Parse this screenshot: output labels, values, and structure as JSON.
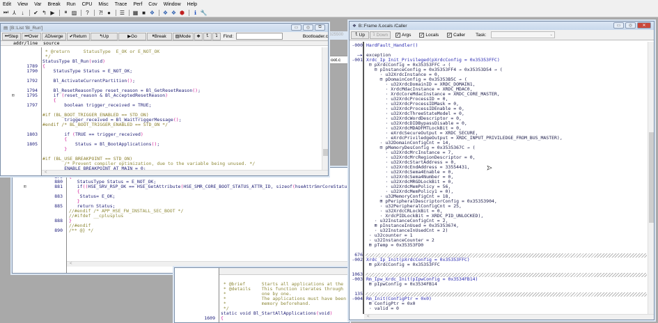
{
  "menu": [
    "Edit",
    "View",
    "Var",
    "Break",
    "Run",
    "CPU",
    "Misc",
    "Trace",
    "Perf",
    "Cov",
    "Window",
    "Help"
  ],
  "toolbar_icons": [
    "step-icon",
    "diverge-icon",
    "over-icon",
    "return-icon",
    "up-icon",
    "go-icon",
    "break-icon",
    "mode-icon",
    "help-icon",
    "context-help-icon",
    "stop-icon",
    "list-icon",
    "memory-icon",
    "register-icon",
    "frame-icon",
    "var-icon",
    "watch-icon",
    "bug-icon",
    "info-icon",
    "tool-icon"
  ],
  "list_window": {
    "title": "[B::List 'Bl_Run']",
    "buttons": [
      "Step",
      "Over",
      "Diverge",
      "Return",
      "Up",
      "Go",
      "Break",
      "Mode"
    ],
    "find_label": "Find:",
    "find_value": "",
    "file": "Bootloader.c",
    "header_addr": "addr/line",
    "header_source": "source",
    "lines": [
      {
        "n": "",
        "t": " * @return     StatusType  E_OK or E_NOT_OK",
        "c": "comment"
      },
      {
        "n": "",
        "t": " */",
        "c": "comment"
      },
      {
        "n": "",
        "t": "StatusType Bl_Run(void)",
        "c": ""
      },
      {
        "n": "1789",
        "t": "{",
        "c": "brace"
      },
      {
        "n": "1790",
        "t": "    StatusType Status = E_NOT_OK;",
        "c": ""
      },
      {
        "n": "",
        "t": "",
        "c": ""
      },
      {
        "n": "1792",
        "t": "    Bl_ActivateCurrentPartition();",
        "c": ""
      },
      {
        "n": "",
        "t": "",
        "c": ""
      },
      {
        "n": "1794",
        "t": "    Bl_ResetReasonType reset_reason = Bl_GetResetReason();",
        "c": ""
      },
      {
        "n": "1795",
        "t": "    if (reset_reason & Bl_AcceptedResetReason)",
        "c": "",
        "fold": true
      },
      {
        "n": "",
        "t": "    {",
        "c": "brace"
      },
      {
        "n": "1797",
        "t": "        boolean trigger_received = TRUE;",
        "c": ""
      },
      {
        "n": "",
        "t": "",
        "c": ""
      },
      {
        "n": "",
        "t": "#if (BL_BOOT_TRIGGER_ENABLED == STD_ON)",
        "c": "pre"
      },
      {
        "n": "",
        "t": "        trigger_received = Bl_WaitTriggerMessage();",
        "c": ""
      },
      {
        "n": "",
        "t": "#endif /* BL_BOOT_TRIGGER_ENABLED == STD_ON */",
        "c": "pre"
      },
      {
        "n": "",
        "t": "",
        "c": ""
      },
      {
        "n": "1803",
        "t": "        if (TRUE == trigger_received)",
        "c": ""
      },
      {
        "n": "",
        "t": "        {",
        "c": "brace"
      },
      {
        "n": "1805",
        "t": "            Status = Bl_BootApplications();",
        "c": ""
      },
      {
        "n": "",
        "t": "        }",
        "c": "brace"
      },
      {
        "n": "",
        "t": "",
        "c": ""
      },
      {
        "n": "",
        "t": "#if (BL_USE_BREAKPOINT == STD_ON)",
        "c": "pre"
      },
      {
        "n": "",
        "t": "        /* Prevent compiler optimization, due to the variable being unused. */",
        "c": "comment"
      },
      {
        "n": "",
        "t": "        ENABLE_BREAKPOINT_AT_MAIN = 0;",
        "c": ""
      }
    ]
  },
  "bg_window": {
    "behind_fragments": [
      "325500",
      "oot.c"
    ],
    "lines": [
      {
        "n": "879",
        "t": "{",
        "c": "brace"
      },
      {
        "n": "880",
        "t": "   StatusType Status = E_NOT_OK;",
        "c": ""
      },
      {
        "n": "881",
        "t": "   if((HSE_SRV_RSP_OK == HSE_GetAttribute(HSE_SMR_CORE_BOOT_STATUS_ATTR_ID, sizeof(hseAttrSmrCoreStatus",
        "c": "",
        "fold": true
      },
      {
        "n": "",
        "t": "   {",
        "c": "brace"
      },
      {
        "n": "883",
        "t": "    Status= E_OK;",
        "c": ""
      },
      {
        "n": "",
        "t": "   }",
        "c": "brace"
      },
      {
        "n": "885",
        "t": "   return Status;",
        "c": ""
      },
      {
        "n": "",
        "t": "//#endif /* APP_HSE_FW_INSTALL_SEC_BOOT */",
        "c": "comment"
      },
      {
        "n": "",
        "t": "//#ifdef __cplusplus",
        "c": "comment"
      },
      {
        "n": "888",
        "t": "}",
        "c": "brace"
      },
      {
        "n": "",
        "t": "//#endif",
        "c": "comment"
      },
      {
        "n": "890",
        "t": "/** @} */",
        "c": "comment"
      }
    ]
  },
  "bg_window2": {
    "lines": [
      {
        "n": "",
        "t": " * @brief      Starts all applications at the",
        "c": "comment"
      },
      {
        "n": "",
        "t": " * @details    This function iterates through",
        "c": "comment"
      },
      {
        "n": "",
        "t": " *             one by one.",
        "c": "comment"
      },
      {
        "n": "",
        "t": " *             The applications must have been",
        "c": "comment"
      },
      {
        "n": "",
        "t": " *             memory beforehand.",
        "c": "comment"
      },
      {
        "n": "",
        "t": " */",
        "c": "comment"
      },
      {
        "n": "",
        "t": "static void Bl_StartAllApplications(void)",
        "c": ""
      },
      {
        "n": "1609",
        "t": "{",
        "c": "brace"
      }
    ]
  },
  "frame_window": {
    "title": "B::Frame /Locals /Caller",
    "up": "Up",
    "down": "Down",
    "checks": [
      {
        "label": "Args",
        "checked": true
      },
      {
        "label": "Locals",
        "checked": true
      },
      {
        "label": "Caller",
        "checked": true
      }
    ],
    "task_label": "Task:",
    "task_value": "",
    "lines": [
      {
        "g": "-000",
        "t": "HardFault_Handler()",
        "c": "fn"
      },
      {
        "g": "",
        "t": "",
        "c": ""
      },
      {
        "g": "—▸",
        "t": "exception",
        "c": ""
      },
      {
        "g": "-001",
        "t": "Xrdc_Ip_Init_Privileged(pXrdcConfig = 0x35353FFC)",
        "c": "fn"
      },
      {
        "g": "",
        "t": " ⊟ pXrdcConfig = 0x35353FFC → (",
        "c": ""
      },
      {
        "g": "",
        "t": "   ⊟ pInstanceConfig = 0x35353FF4 → 0x35353D54 → (",
        "c": ""
      },
      {
        "g": "",
        "t": "     · u32XrdcInstance = 0,",
        "c": ""
      },
      {
        "g": "",
        "t": "     ⊟ pDomainConfig = 0x35353B5C → (",
        "c": ""
      },
      {
        "g": "",
        "t": "       · u32XrdcDomainID = XRDC_DOMAIN1,",
        "c": ""
      },
      {
        "g": "",
        "t": "       · XrdcMdacInstance = XRDC_MDAC0,",
        "c": ""
      },
      {
        "g": "",
        "t": "       · XrdcCoreMdacInstance = XRDC_CORE_MASTER,",
        "c": ""
      },
      {
        "g": "",
        "t": "       · u32XrdcProcessID = 0,",
        "c": ""
      },
      {
        "g": "",
        "t": "       · u32XrdcProcessIDMask = 0,",
        "c": ""
      },
      {
        "g": "",
        "t": "       · u32XrdcProcessIDEnable = 0,",
        "c": ""
      },
      {
        "g": "",
        "t": "       · u32XrdcThreeStateModel = 0,",
        "c": ""
      },
      {
        "g": "",
        "t": "       · u32XrdcWordDescriptor = 0,",
        "c": ""
      },
      {
        "g": "",
        "t": "       · u32XrdcDIDBypassDisable = 0,",
        "c": ""
      },
      {
        "g": "",
        "t": "       · u32XrdcMDADFMTLockBit = 0,",
        "c": ""
      },
      {
        "g": "",
        "t": "       · eXrdcSecureOutput = XRDC_SECURE,",
        "c": ""
      },
      {
        "g": "",
        "t": "       · eXrdcPriviledgeOutput = XRDC_INPUT_PRIVILEDGE_FROM_BUS_MASTER),",
        "c": ""
      },
      {
        "g": "",
        "t": "     · u32DomainConfigCnt = 14,",
        "c": ""
      },
      {
        "g": "",
        "t": "     ⊟ pMemoryDesConfig = 0x3535367C → (",
        "c": ""
      },
      {
        "g": "",
        "t": "       · u32XrdcMrcInstance = 7,",
        "c": ""
      },
      {
        "g": "",
        "t": "       · u32XrdcMrcRegionDescriptor = 0,",
        "c": ""
      },
      {
        "g": "",
        "t": "       · u32XrdcStartAddress = 0,",
        "c": ""
      },
      {
        "g": "",
        "t": "       · u32XrdcEndAddress = 33554431,",
        "c": ""
      },
      {
        "g": "",
        "t": "       · u32XrdcSema4Enable = 0,",
        "c": ""
      },
      {
        "g": "",
        "t": "       · u32XrdcSema4Number = 0,",
        "c": ""
      },
      {
        "g": "",
        "t": "       · u32XrdcMRGDLockBit = 0,",
        "c": ""
      },
      {
        "g": "",
        "t": "       · u32XrdcMemPolicy = 56,",
        "c": ""
      },
      {
        "g": "",
        "t": "       · u32XrdcMemPolicy1 = 0),",
        "c": ""
      },
      {
        "g": "",
        "t": "     · u32MemoryConfigCnt = 18,",
        "c": ""
      },
      {
        "g": "",
        "t": "     ⊞ pPeripheralDescriptorConfig = 0x35353904,",
        "c": ""
      },
      {
        "g": "",
        "t": "     · u32PeripheralConfigCnt = 25,",
        "c": ""
      },
      {
        "g": "",
        "t": "     · u32XrdcCRLockBit = 0,",
        "c": ""
      },
      {
        "g": "",
        "t": "     · XrdcPIDLockBit = XRDC_PID_UNLOCKED),",
        "c": ""
      },
      {
        "g": "",
        "t": "   · u32InstanceConfigCnt = 2,",
        "c": ""
      },
      {
        "g": "",
        "t": "   ⊞ pInstanceInUsed = 0x35353674,",
        "c": ""
      },
      {
        "g": "",
        "t": "   · u32InstanceInUsedCnt = 2)",
        "c": ""
      },
      {
        "g": "",
        "t": " · u32counter = 1",
        "c": ""
      },
      {
        "g": "",
        "t": " · u32InstanceCounter = 2",
        "c": ""
      },
      {
        "g": "",
        "t": " ⊞ pTemp = 0x35353FD0",
        "c": ""
      },
      {
        "g": "",
        "t": "",
        "c": ""
      },
      {
        "g": "676",
        "t": "",
        "c": "hatch"
      },
      {
        "g": "-002",
        "t": "Xrdc_Ip_Init(pXrdcConfig = 0x35353FFC)",
        "c": "fn"
      },
      {
        "g": "",
        "t": " ⊞ pXrdcConfig = 0x35353FFC",
        "c": ""
      },
      {
        "g": "",
        "t": "",
        "c": ""
      },
      {
        "g": "1063",
        "t": "",
        "c": "hatch"
      },
      {
        "g": "-003",
        "t": "Rm_Ipw_Xrdc_Init(pIpwConfig = 0x3534FB14)",
        "c": "fn"
      },
      {
        "g": "",
        "t": " ⊞ pIpwConfig = 0x3534FB14",
        "c": ""
      },
      {
        "g": "",
        "t": "",
        "c": ""
      },
      {
        "g": "135",
        "t": "",
        "c": "hatch"
      },
      {
        "g": "-004",
        "t": "Rm_Init(ConfigPtr = 0x0)",
        "c": "fn"
      },
      {
        "g": "",
        "t": " ⊞ ConfigPtr = 0x0",
        "c": ""
      },
      {
        "g": "",
        "t": " · valid = 0",
        "c": ""
      }
    ]
  }
}
